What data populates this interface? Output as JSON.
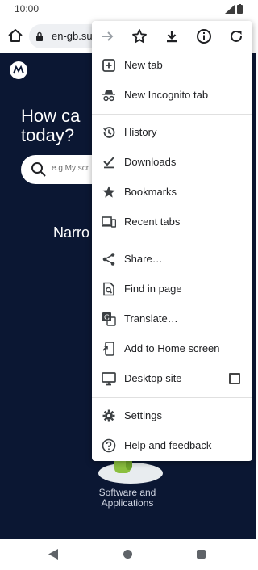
{
  "status_bar": {
    "time": "10:00"
  },
  "toolbar": {
    "url": "en-gb.sup"
  },
  "page": {
    "hero": "How ca\ntoday?",
    "search_placeholder": "e.g My scr",
    "narrow": "Narro",
    "software_label": "Software and\nApplications"
  },
  "menu": {
    "top_icons": [
      "forward-icon",
      "star-icon",
      "download-icon",
      "info-icon",
      "refresh-icon"
    ],
    "items": [
      {
        "label": "New tab",
        "icon": "plus-box-icon"
      },
      {
        "label": "New Incognito tab",
        "icon": "incognito-icon"
      },
      {
        "label": "History",
        "icon": "history-icon"
      },
      {
        "label": "Downloads",
        "icon": "download-check-icon"
      },
      {
        "label": "Bookmarks",
        "icon": "star-filled-icon"
      },
      {
        "label": "Recent tabs",
        "icon": "devices-icon"
      },
      {
        "label": "Share…",
        "icon": "share-icon"
      },
      {
        "label": "Find in page",
        "icon": "find-in-page-icon"
      },
      {
        "label": "Translate…",
        "icon": "translate-icon"
      },
      {
        "label": "Add to Home screen",
        "icon": "add-to-home-icon"
      },
      {
        "label": "Desktop site",
        "icon": "monitor-icon",
        "checked": false
      },
      {
        "label": "Settings",
        "icon": "gear-icon"
      },
      {
        "label": "Help and feedback",
        "icon": "help-icon"
      }
    ]
  },
  "colors": {
    "page_bg": "#0b1733",
    "menu_text": "#202124",
    "icon": "#3c4043"
  }
}
